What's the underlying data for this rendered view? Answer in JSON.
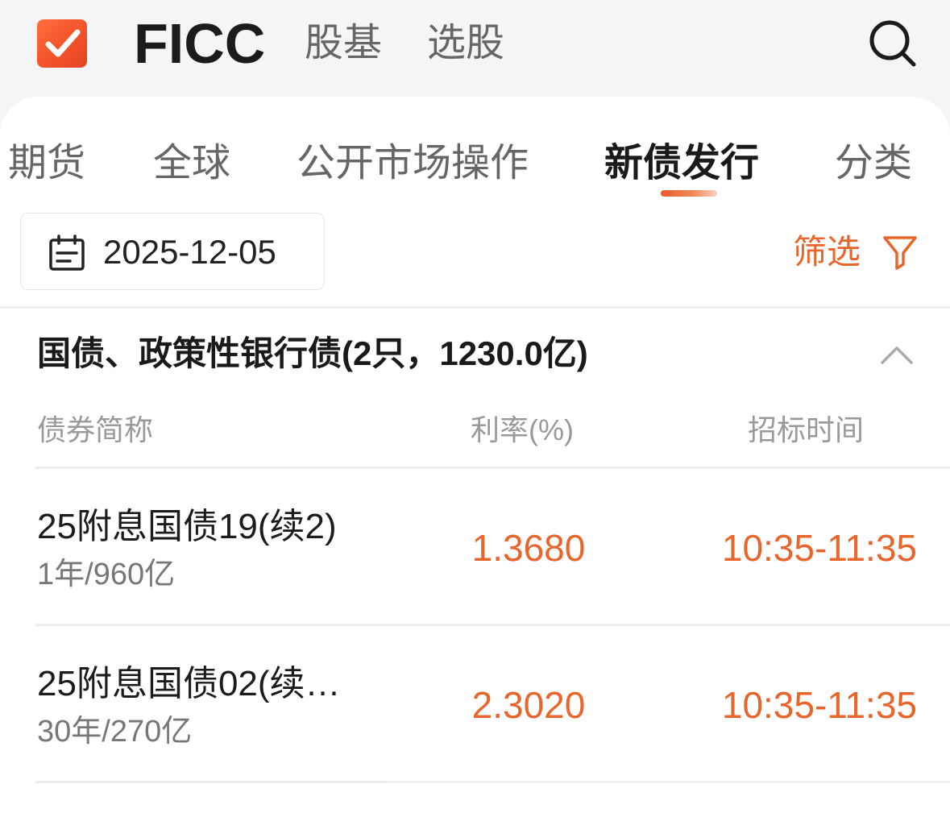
{
  "header": {
    "tabs": [
      {
        "label": "FICC",
        "active": true
      },
      {
        "label": "股基",
        "active": false
      },
      {
        "label": "选股",
        "active": false
      }
    ],
    "logo_icon": "checkmark-app-icon",
    "search_icon": "search-icon"
  },
  "subtabs": [
    {
      "label": "期货",
      "active": false
    },
    {
      "label": "全球",
      "active": false
    },
    {
      "label": "公开市场操作",
      "active": false
    },
    {
      "label": "新债发行",
      "active": true
    },
    {
      "label": "分类",
      "active": false
    }
  ],
  "filters": {
    "date": "2025-12-05",
    "filter_label": "筛选"
  },
  "section": {
    "title": "国债、政策性银行债(2只，1230.0亿)",
    "expanded": true
  },
  "table": {
    "columns": [
      "债券简称",
      "利率(%)",
      "招标时间"
    ],
    "rows": [
      {
        "name": "25附息国债19(续2)",
        "sub": "1年/960亿",
        "rate": "1.3680",
        "time": "10:35-11:35"
      },
      {
        "name": "25附息国债02(续…",
        "sub": "30年/270亿",
        "rate": "2.3020",
        "time": "10:35-11:35"
      }
    ]
  },
  "colors": {
    "accent": "#e8652c",
    "background": "#f5f5f7",
    "card": "#ffffff"
  }
}
